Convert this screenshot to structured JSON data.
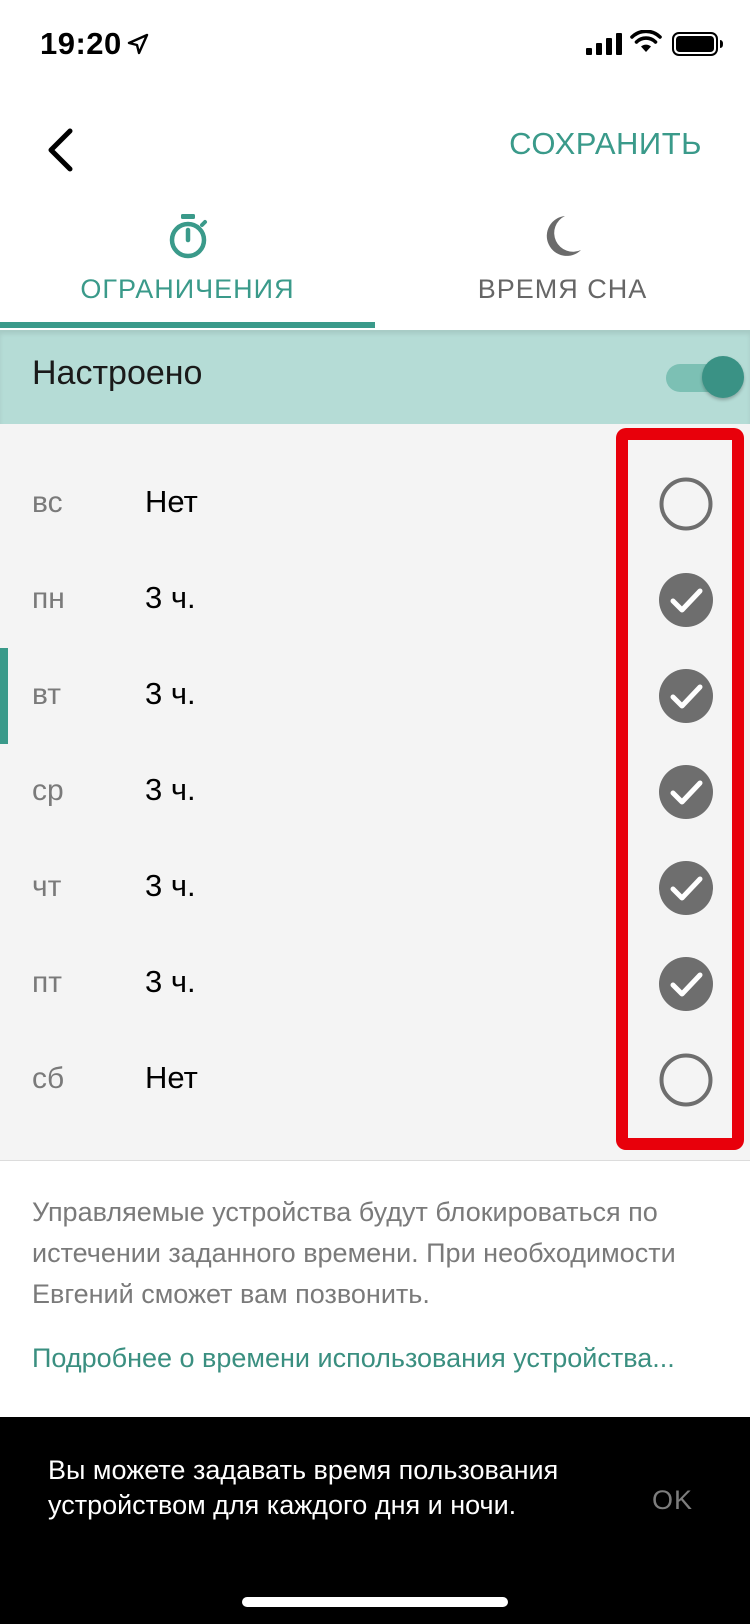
{
  "status_bar": {
    "time": "19:20",
    "location_icon": "location-arrow-icon",
    "signal_icon": "cellular-signal-icon",
    "wifi_icon": "wifi-icon",
    "battery_icon": "battery-icon"
  },
  "header": {
    "back_icon": "chevron-left-icon",
    "save_label": "СОХРАНИТЬ"
  },
  "tabs": [
    {
      "label": "ОГРАНИЧЕНИЯ",
      "icon": "stopwatch-icon",
      "selected": true
    },
    {
      "label": "ВРЕМЯ СНА",
      "icon": "moon-icon",
      "selected": false
    }
  ],
  "configured": {
    "label": "Настроено",
    "enabled": true
  },
  "days": [
    {
      "day": "вс",
      "value": "Нет",
      "checked": false
    },
    {
      "day": "пн",
      "value": "3 ч.",
      "checked": true
    },
    {
      "day": "вт",
      "value": "3 ч.",
      "checked": true
    },
    {
      "day": "ср",
      "value": "3 ч.",
      "checked": true
    },
    {
      "day": "чт",
      "value": "3 ч.",
      "checked": true
    },
    {
      "day": "пт",
      "value": "3 ч.",
      "checked": true
    },
    {
      "day": "сб",
      "value": "Нет",
      "checked": false
    }
  ],
  "info": {
    "text": "Управляемые устройства будут блокироваться по истечении заданного времени. При необходимости Евгений сможет вам позвонить.",
    "link": "Подробнее о времени использования устройства..."
  },
  "snackbar": {
    "text": "Вы можете задавать время пользования устройством для каждого дня и ночи.",
    "action": "OK"
  },
  "colors": {
    "accent": "#3a9a8a",
    "configured_bg": "#b5dcd6",
    "annotation_frame": "#e8000b"
  }
}
